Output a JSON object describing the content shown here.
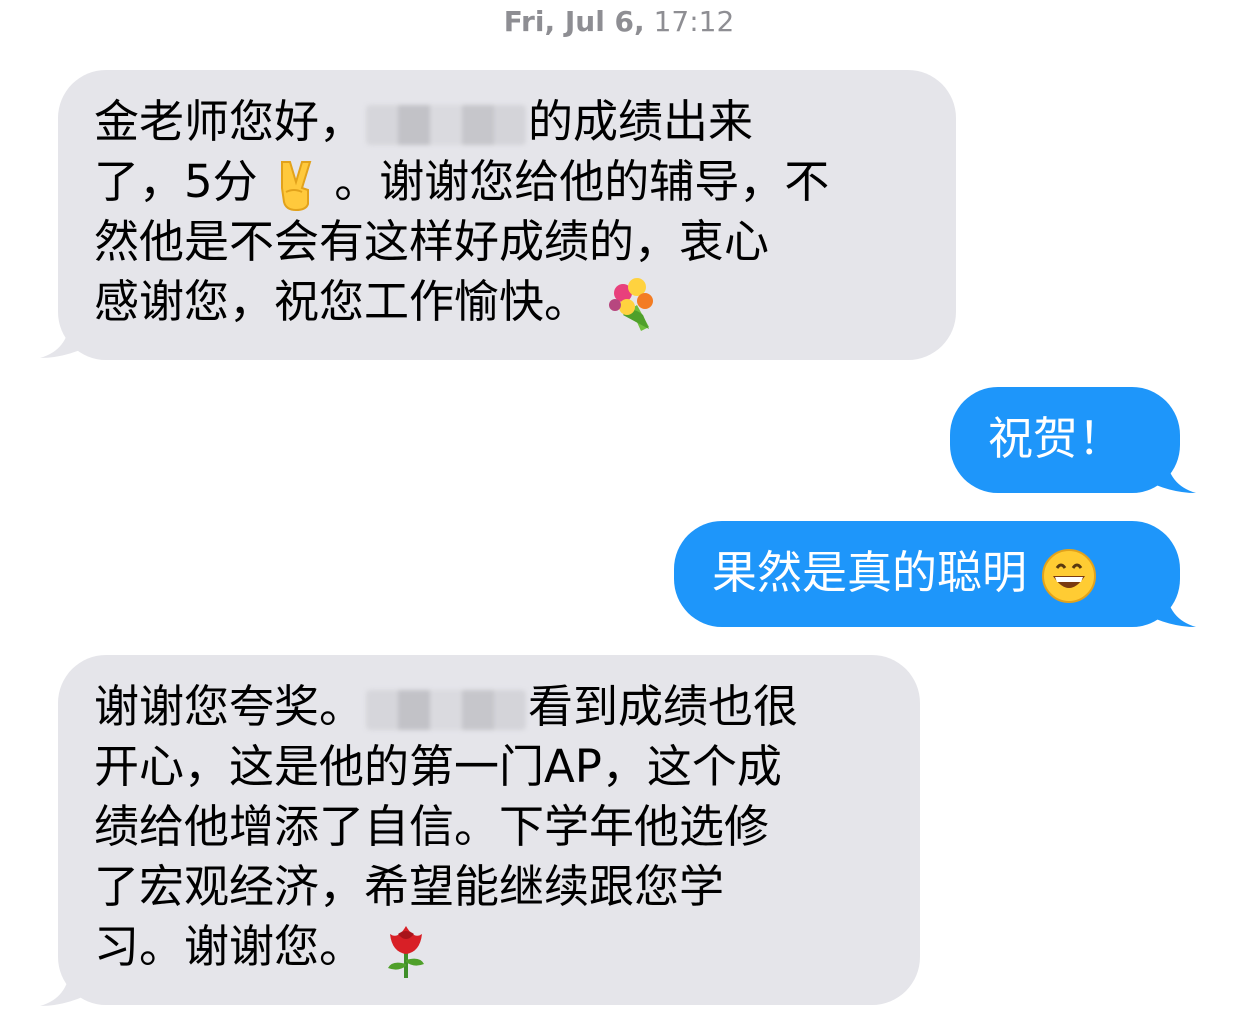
{
  "timestamp": {
    "date": "Fri, Jul 6,",
    "time": "17:12"
  },
  "messages": [
    {
      "direction": "incoming",
      "lines": [
        {
          "before": "金老师您好，",
          "redacted": true,
          "after": "的成绩出来"
        },
        {
          "before": "了，5分",
          "emoji": "victory-hand-emoji",
          "after": "。谢谢您给他的辅导，不"
        },
        {
          "text": "然他是不会有这样好成绩的，衷心"
        },
        {
          "before": "感谢您，祝您工作愉快。",
          "emoji": "bouquet-emoji"
        }
      ]
    },
    {
      "direction": "outgoing",
      "text": "祝贺！"
    },
    {
      "direction": "outgoing",
      "text": "果然是真的聪明",
      "emoji": "grinning-face-emoji"
    },
    {
      "direction": "incoming",
      "lines": [
        {
          "before": "谢谢您夸奖。",
          "redacted": true,
          "after": "看到成绩也很"
        },
        {
          "text": "开心，这是他的第一门AP，这个成"
        },
        {
          "text": "绩给他增添了自信。下学年他选修"
        },
        {
          "text": "了宏观经济，希望能继续跟您学"
        },
        {
          "before": "习。谢谢您。",
          "emoji": "rose-emoji"
        }
      ]
    }
  ],
  "colors": {
    "incoming_bubble": "#e5e5ea",
    "outgoing_bubble": "#1e96fa",
    "timestamp_text": "#8e8e93"
  }
}
